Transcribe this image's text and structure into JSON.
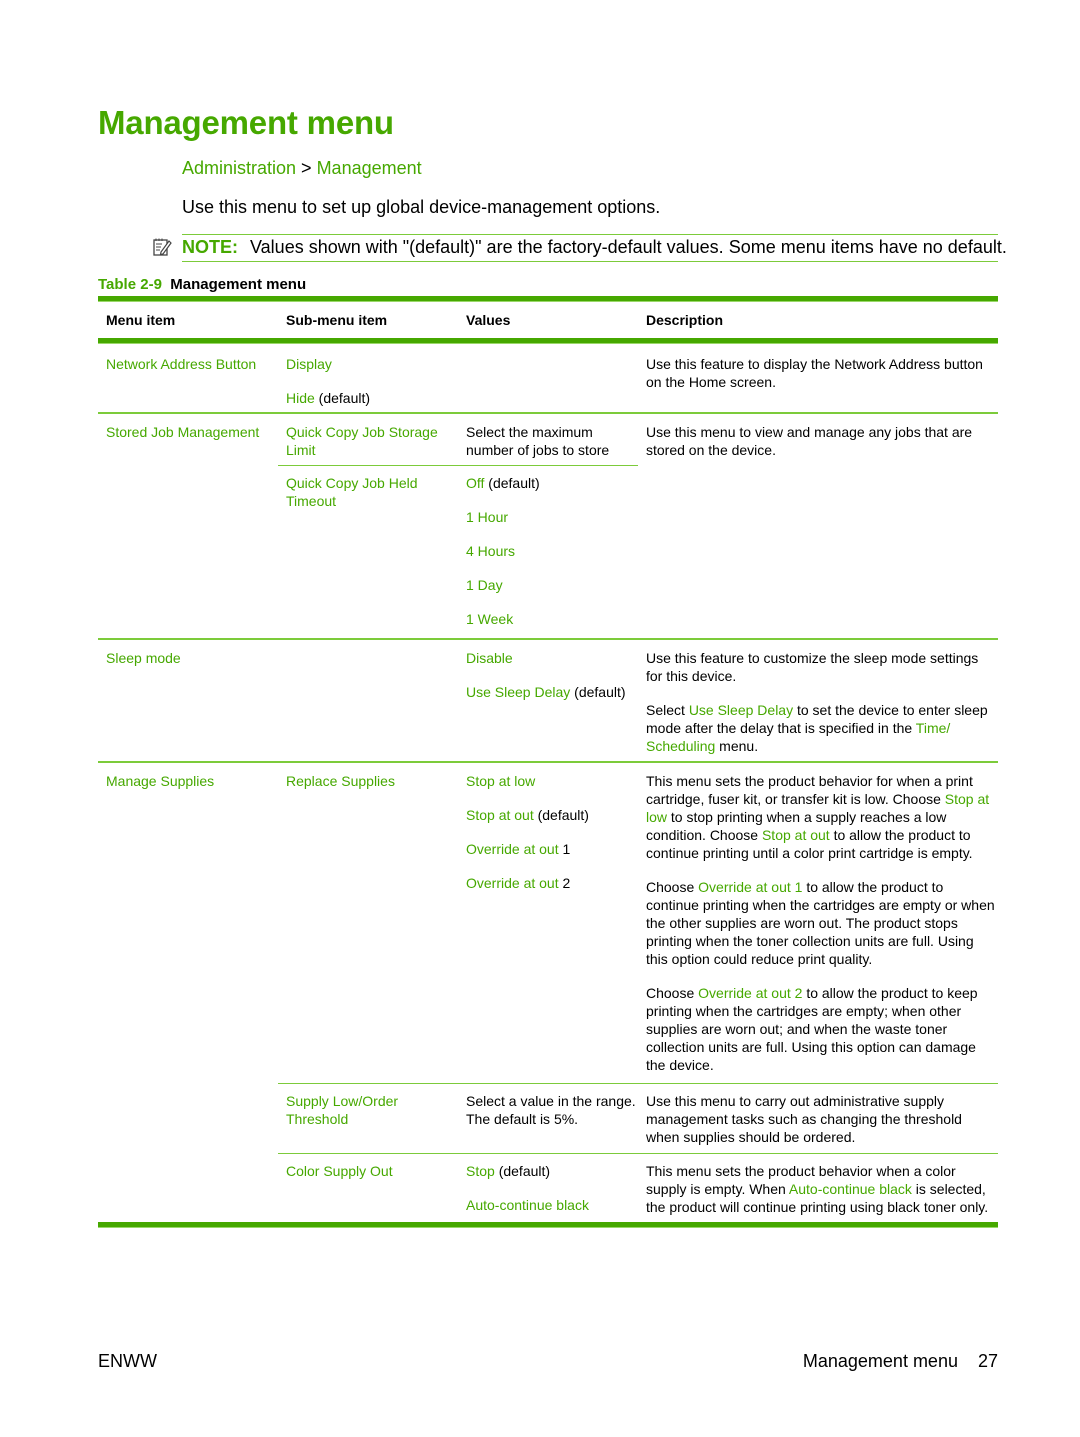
{
  "page_title": "Management menu",
  "breadcrumb": {
    "part1": "Administration",
    "separator": " > ",
    "part2": "Management"
  },
  "intro": "Use this menu to set up global device-management options.",
  "note": {
    "icon": "note-pencil-icon",
    "label": "NOTE:",
    "text": "Values shown with \"(default)\" are the factory-default values. Some menu items have no default."
  },
  "caption": {
    "prefix": "Table 2-9",
    "title": "Management menu"
  },
  "table": {
    "headers": [
      "Menu item",
      "Sub-menu item",
      "Values",
      "Description"
    ],
    "rows": {
      "network": {
        "menu_item": "Network Address Button",
        "sub1": {
          "label": "Display"
        },
        "sub2": {
          "label": "Hide",
          "suffix": " (default)"
        },
        "description": "Use this feature to display the Network Address button on the Home screen."
      },
      "stored": {
        "menu_item": "Stored Job Management",
        "storage_limit": {
          "label": "Quick Copy Job Storage Limit",
          "value": "Select the maximum number of jobs to store"
        },
        "description": "Use this menu to view and manage any jobs that are stored on the device.",
        "held_timeout": {
          "label": "Quick Copy Job Held Timeout",
          "values": [
            {
              "label": "Off",
              "suffix": " (default)"
            },
            {
              "label": "1 Hour",
              "suffix": ""
            },
            {
              "label": "4 Hours",
              "suffix": ""
            },
            {
              "label": "1 Day",
              "suffix": ""
            },
            {
              "label": "1 Week",
              "suffix": ""
            }
          ]
        }
      },
      "sleep": {
        "menu_item": "Sleep mode",
        "values": [
          {
            "label": "Disable",
            "suffix": ""
          },
          {
            "label": "Use Sleep Delay",
            "suffix": " (default)"
          }
        ],
        "desc1": "Use this feature to customize the sleep mode settings for this device.",
        "desc2": {
          "a": "Select ",
          "link1": "Use Sleep Delay",
          "b": " to set the device to enter sleep mode after the delay that is specified in the ",
          "link2": "Time/ Scheduling",
          "c": " menu."
        }
      },
      "supplies": {
        "menu_item": "Manage Supplies",
        "replace": {
          "label": "Replace Supplies",
          "values": [
            {
              "label": "Stop at low",
              "suffix": ""
            },
            {
              "label": "Stop at out",
              "suffix": " (default)"
            },
            {
              "label": "Override at out",
              "suffix": " 1"
            },
            {
              "label": "Override at out",
              "suffix": " 2"
            }
          ],
          "desc1": {
            "a": "This menu sets the product behavior for when a print cartridge, fuser kit, or transfer kit is low. Choose ",
            "link1": "Stop at low",
            "b": " to stop printing when a supply reaches a low condition. Choose ",
            "link2": "Stop at out",
            "c": " to allow the product to continue printing until a color print cartridge is empty."
          },
          "desc2": {
            "a": "Choose ",
            "link": "Override at out 1",
            "b": " to allow the product to continue printing when the cartridges are empty or when the other supplies are worn out. The product stops printing when the toner collection units are full. Using this option could reduce print quality."
          },
          "desc3": {
            "a": "Choose ",
            "link": "Override at out 2",
            "b": " to allow the product to keep printing when the cartridges are empty; when other supplies are worn out; and when the waste toner collection units are full. Using this option can damage the device."
          }
        },
        "threshold": {
          "label": "Supply Low/Order Threshold",
          "value": "Select a value in the range. The default is 5%.",
          "description": "Use this menu to carry out administrative supply management tasks such as changing the threshold when supplies should be ordered."
        },
        "color_out": {
          "label": "Color Supply Out",
          "values": [
            {
              "label": "Stop",
              "suffix": " (default)"
            },
            {
              "label": "Auto-continue black",
              "suffix": ""
            }
          ],
          "desc": {
            "a": "This menu sets the product behavior when a color supply is empty. When ",
            "link": "Auto-continue black",
            "b": " is selected, the product will continue printing using black toner only."
          }
        }
      }
    }
  },
  "footer": {
    "left": "ENWW",
    "section": "Management menu",
    "page": "27"
  },
  "colors": {
    "accent": "#46a800",
    "rule": "#7ccb3a"
  }
}
